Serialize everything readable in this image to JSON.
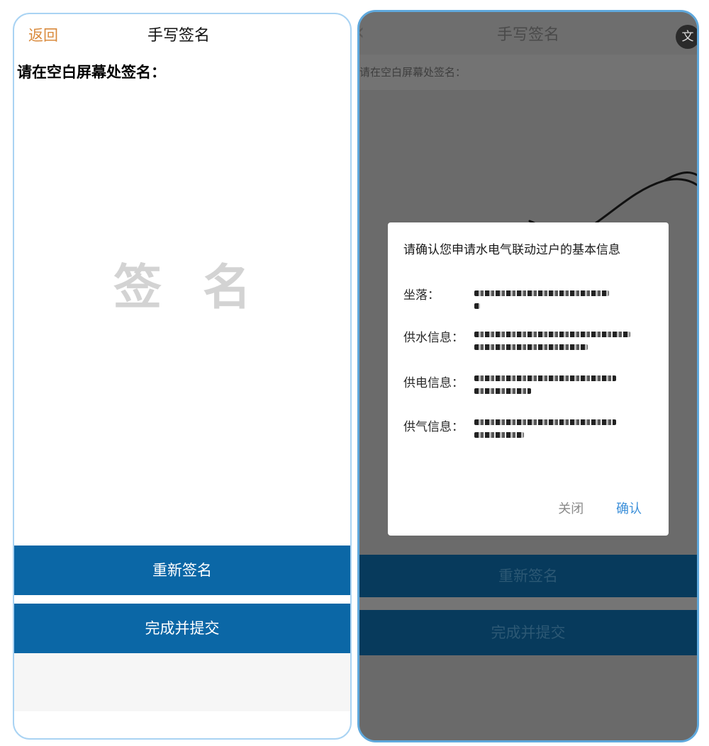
{
  "left_screen": {
    "header": {
      "back_label": "返回",
      "title": "手写签名"
    },
    "instruction": "请在空白屏幕处签名：",
    "canvas_hint": "签名",
    "buttons": {
      "resign": "重新签名",
      "submit": "完成并提交"
    }
  },
  "right_screen": {
    "header": {
      "back_icon": "chevron-left-icon",
      "title": "手写签名",
      "translate_label": "文"
    },
    "instruction": "请在空白屏幕处签名：",
    "dialog": {
      "title": "请确认您申请水电气联动过户的基本信息",
      "rows": [
        {
          "label": "坐落："
        },
        {
          "label": "供水信息："
        },
        {
          "label": "供电信息："
        },
        {
          "label": "供气信息："
        }
      ],
      "close_label": "关闭",
      "confirm_label": "确认"
    },
    "buttons": {
      "resign": "重新签名",
      "submit": "完成并提交"
    }
  },
  "colors": {
    "primary_button": "#0b67a6",
    "back_link": "#d98a3c",
    "confirm_link": "#3b8fd9",
    "frame_border": "#a9d3f3"
  }
}
